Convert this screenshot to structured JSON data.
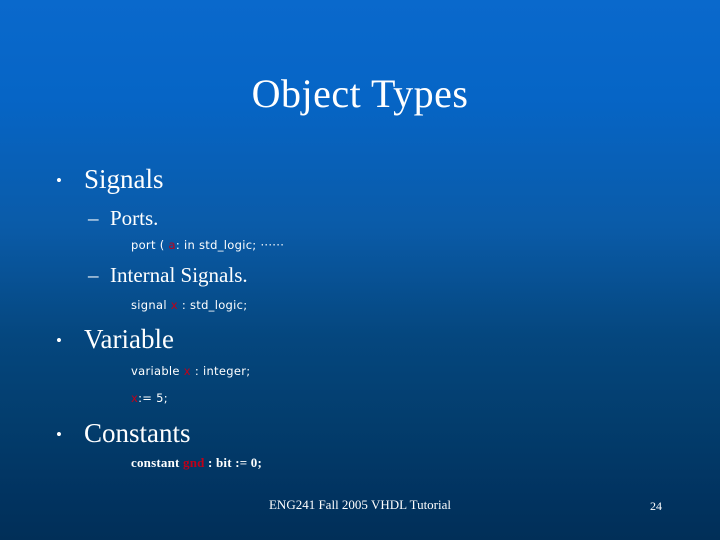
{
  "slide": {
    "title": "Object Types",
    "background": {
      "top_color": "#0a69cc",
      "bottom_color": "#012f58"
    },
    "accent_color": "#c00018",
    "text_color": "#ffffff"
  },
  "bullets": {
    "b1": {
      "marker": "•",
      "label": "Signals"
    },
    "b1_sub1": {
      "marker": "–",
      "label": "Ports."
    },
    "b1_sub1_code": {
      "before": "port  ( ",
      "identifier": "a",
      "after": ": in std_logic; ······"
    },
    "b1_sub2": {
      "marker": "–",
      "label": "Internal Signals."
    },
    "b1_sub2_code": {
      "before": "signal ",
      "identifier": "x",
      "after": " : std_logic;"
    },
    "b2": {
      "marker": "•",
      "label": "Variable"
    },
    "b2_code1": {
      "before": "variable ",
      "identifier": "x",
      "after": " : integer;"
    },
    "b2_code2": {
      "before": "",
      "identifier": "x",
      "after": ":= 5;"
    },
    "b3": {
      "marker": "•",
      "label": "Constants"
    },
    "b3_code1": {
      "before": "constant ",
      "identifier": "gnd",
      "after": " : bit := 0;"
    }
  },
  "footer": {
    "text": "ENG241 Fall 2005 VHDL Tutorial",
    "page_number": "24"
  }
}
